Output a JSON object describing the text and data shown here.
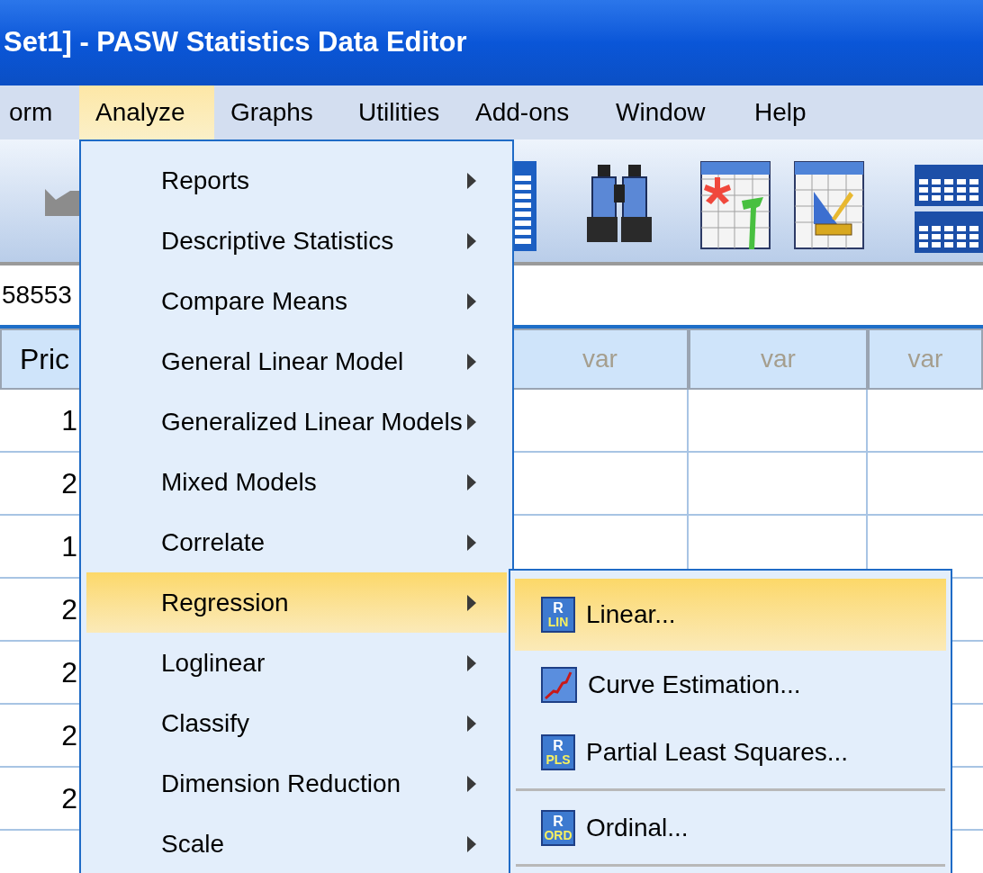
{
  "window": {
    "title": "Set1] - PASW Statistics Data Editor"
  },
  "menu_bar": [
    {
      "label": "orm",
      "selected": false
    },
    {
      "label": "Analyze",
      "selected": true
    },
    {
      "label": "Graphs",
      "selected": false
    },
    {
      "label": "Utilities",
      "selected": false
    },
    {
      "label": "Add-ons",
      "selected": false
    },
    {
      "label": "Window",
      "selected": false
    },
    {
      "label": "Help",
      "selected": false
    }
  ],
  "cell_editor": {
    "value": "58553"
  },
  "grid": {
    "columns": [
      "Pric",
      "var",
      "var",
      "var"
    ],
    "rows": [
      "1",
      "2",
      "1",
      "2",
      "2",
      "2",
      "2"
    ]
  },
  "analyze_menu": [
    {
      "label": "Reports",
      "selected": false,
      "submenu": true
    },
    {
      "label": "Descriptive Statistics",
      "selected": false,
      "submenu": true
    },
    {
      "label": "Compare Means",
      "selected": false,
      "submenu": true
    },
    {
      "label": "General Linear Model",
      "selected": false,
      "submenu": true
    },
    {
      "label": "Generalized Linear Models",
      "selected": false,
      "submenu": true
    },
    {
      "label": "Mixed Models",
      "selected": false,
      "submenu": true
    },
    {
      "label": "Correlate",
      "selected": false,
      "submenu": true
    },
    {
      "label": "Regression",
      "selected": true,
      "submenu": true
    },
    {
      "label": "Loglinear",
      "selected": false,
      "submenu": true
    },
    {
      "label": "Classify",
      "selected": false,
      "submenu": true
    },
    {
      "label": "Dimension Reduction",
      "selected": false,
      "submenu": true
    },
    {
      "label": "Scale",
      "selected": false,
      "submenu": true
    }
  ],
  "regression_menu": [
    {
      "kind": "lettered",
      "label": "Linear...",
      "selected": true,
      "icon_letter": "R",
      "icon_tag": "LIN"
    },
    {
      "kind": "chart",
      "label": "Curve Estimation...",
      "selected": false
    },
    {
      "kind": "lettered",
      "label": "Partial Least Squares...",
      "selected": false,
      "icon_letter": "R",
      "icon_tag": "PLS"
    },
    {
      "kind": "separator"
    },
    {
      "kind": "lettered",
      "label": "Ordinal...",
      "selected": false,
      "icon_letter": "R",
      "icon_tag": "ORD"
    },
    {
      "kind": "separator"
    }
  ]
}
